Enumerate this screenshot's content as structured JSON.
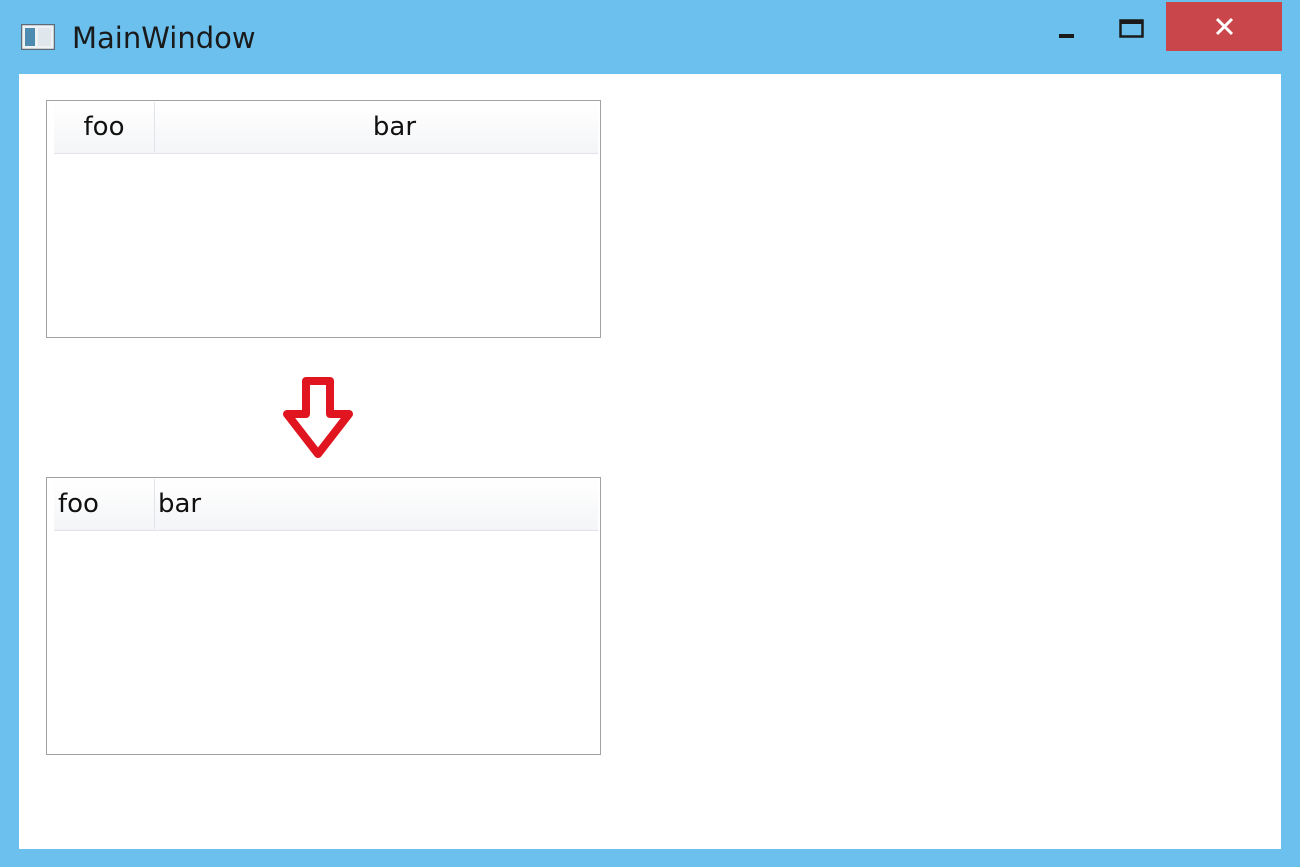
{
  "window": {
    "title": "MainWindow",
    "controls": {
      "minimize_icon": "minimize-icon",
      "maximize_icon": "maximize-icon",
      "close_icon": "close-icon"
    }
  },
  "listviews": [
    {
      "columns": [
        {
          "label": "foo",
          "align": "center"
        },
        {
          "label": "bar",
          "align": "center"
        }
      ],
      "rows": []
    },
    {
      "columns": [
        {
          "label": "foo",
          "align": "left"
        },
        {
          "label": "bar",
          "align": "left"
        }
      ],
      "rows": []
    }
  ],
  "annotation": {
    "icon": "down-arrow-icon",
    "color": "#e0151f"
  },
  "colors": {
    "frame": "#6bc0ee",
    "close_button": "#c9474b",
    "client_bg": "#ffffff"
  }
}
